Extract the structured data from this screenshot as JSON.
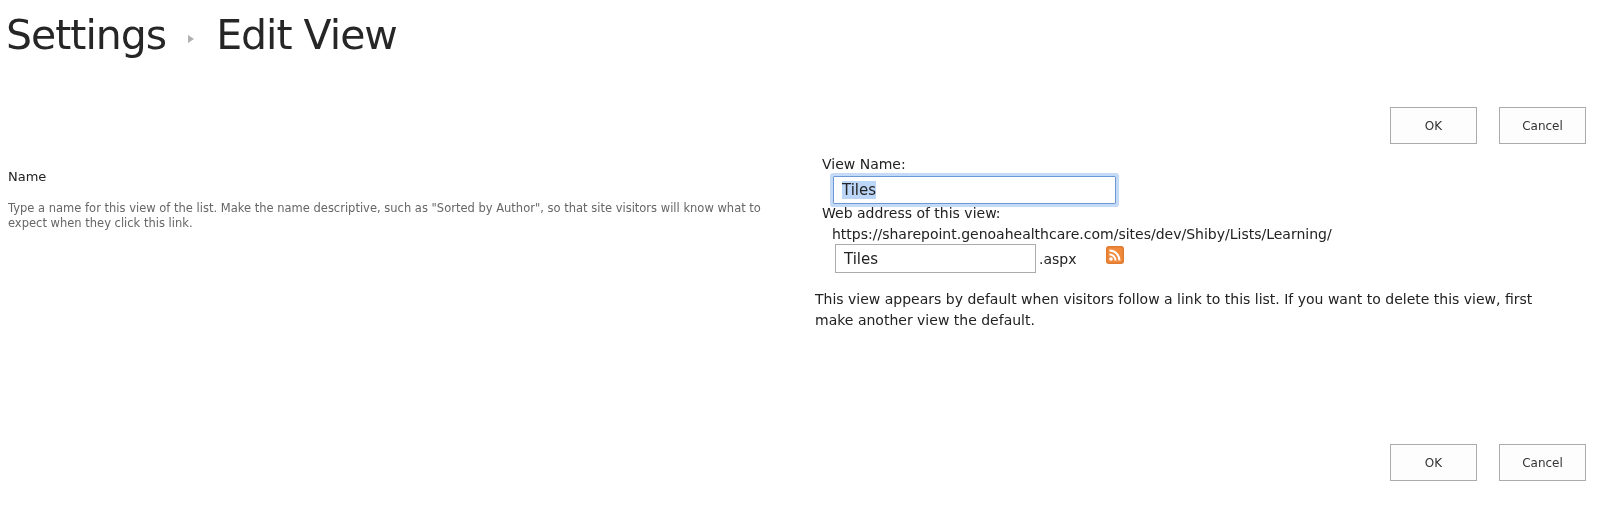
{
  "breadcrumb": [
    {
      "label": "Settings"
    },
    {
      "label": "Edit View"
    }
  ],
  "top_buttons": [
    "OK",
    "Cancel"
  ],
  "section": {
    "title": "Name",
    "description": "Type a name for this view of the list. Make the name descriptive, such as \"Sorted by Author\", so that site visitors will know what to expect when they click this link."
  },
  "view_name": {
    "label": "View Name:",
    "value": "Tiles",
    "focused": true
  },
  "web_address": {
    "label": "Web address of this view:",
    "url": "https://sharepoint.genoahealthcare.com/sites/dev/Shiby/Lists/Learning/",
    "value": "Tiles",
    "suffix": ".aspx"
  },
  "note": "This view appears by default when visitors follow a link to this list. If you want to delete this view, first make another view the default.",
  "bottom_buttons": [
    "OK",
    "Cancel"
  ]
}
